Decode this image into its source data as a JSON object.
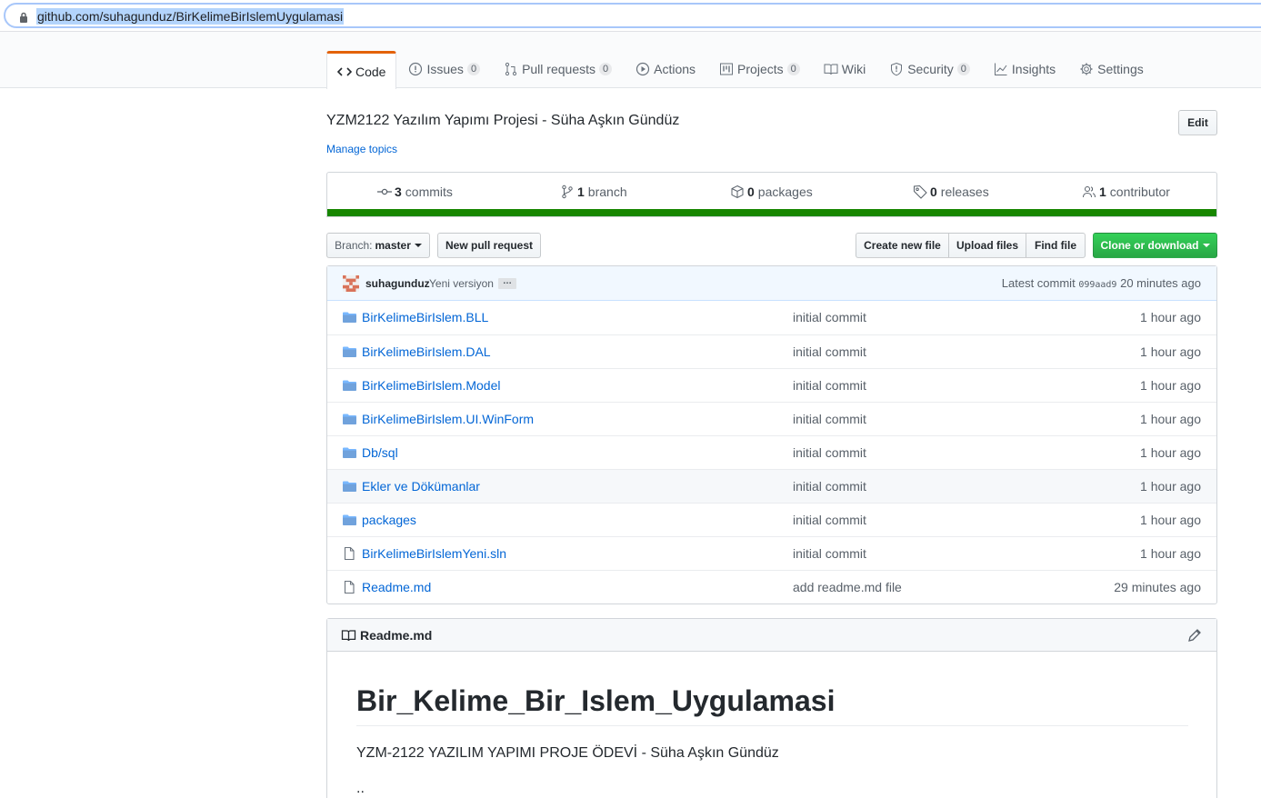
{
  "browser": {
    "url": "github.com/suhagunduz/BirKelimeBirIslemUygulamasi"
  },
  "tabs": [
    {
      "label": "Code",
      "count": null,
      "icon": "code-icon"
    },
    {
      "label": "Issues",
      "count": "0",
      "icon": "issue-icon"
    },
    {
      "label": "Pull requests",
      "count": "0",
      "icon": "pull-request-icon"
    },
    {
      "label": "Actions",
      "count": null,
      "icon": "play-icon"
    },
    {
      "label": "Projects",
      "count": "0",
      "icon": "project-icon"
    },
    {
      "label": "Wiki",
      "count": null,
      "icon": "book-icon"
    },
    {
      "label": "Security",
      "count": "0",
      "icon": "shield-icon"
    },
    {
      "label": "Insights",
      "count": null,
      "icon": "graph-icon"
    },
    {
      "label": "Settings",
      "count": null,
      "icon": "gear-icon"
    }
  ],
  "repo": {
    "description": "YZM2122 Yazılım Yapımı Projesi - Süha Aşkın Gündüz",
    "manage_topics": "Manage topics",
    "edit_label": "Edit"
  },
  "summary": {
    "commits": {
      "count": "3",
      "label": "commits"
    },
    "branches": {
      "count": "1",
      "label": "branch"
    },
    "packages": {
      "count": "0",
      "label": "packages"
    },
    "releases": {
      "count": "0",
      "label": "releases"
    },
    "contributors": {
      "count": "1",
      "label": "contributor"
    },
    "language_color": "#178600"
  },
  "filenav": {
    "branch_label": "Branch:",
    "branch_name": "master",
    "new_pr": "New pull request",
    "create_file": "Create new file",
    "upload_files": "Upload files",
    "find_file": "Find file",
    "clone": "Clone or download"
  },
  "commit_tease": {
    "author": "suhagunduz",
    "message": "Yeni versiyon",
    "ellipsis": "…",
    "latest_label": "Latest commit",
    "sha": "099aad9",
    "age": "20 minutes ago"
  },
  "files": [
    {
      "type": "dir",
      "name": "BirKelimeBirIslem.BLL",
      "message": "initial commit",
      "age": "1 hour ago"
    },
    {
      "type": "dir",
      "name": "BirKelimeBirIslem.DAL",
      "message": "initial commit",
      "age": "1 hour ago"
    },
    {
      "type": "dir",
      "name": "BirKelimeBirIslem.Model",
      "message": "initial commit",
      "age": "1 hour ago"
    },
    {
      "type": "dir",
      "name": "BirKelimeBirIslem.UI.WinForm",
      "message": "initial commit",
      "age": "1 hour ago"
    },
    {
      "type": "dir",
      "name": "Db/sql",
      "message": "initial commit",
      "age": "1 hour ago"
    },
    {
      "type": "dir",
      "name": "Ekler ve Dökümanlar",
      "message": "initial commit",
      "age": "1 hour ago"
    },
    {
      "type": "dir",
      "name": "packages",
      "message": "initial commit",
      "age": "1 hour ago"
    },
    {
      "type": "file",
      "name": "BirKelimeBirIslemYeni.sln",
      "message": "initial commit",
      "age": "1 hour ago"
    },
    {
      "type": "file",
      "name": "Readme.md",
      "message": "add readme.md file",
      "age": "29 minutes ago"
    }
  ],
  "readme": {
    "filename": "Readme.md",
    "heading": "Bir_Kelime_Bir_Islem_Uygulamasi",
    "paragraph": "YZM-2122 YAZILIM YAPIMI PROJE ÖDEVİ - Süha Aşkın Gündüz",
    "paragraph2": ".."
  },
  "colors": {
    "link": "#0366d6",
    "selected_tab_accent": "#e36209",
    "clone_button": "#28a745",
    "folder_icon": "#79b8ff"
  }
}
